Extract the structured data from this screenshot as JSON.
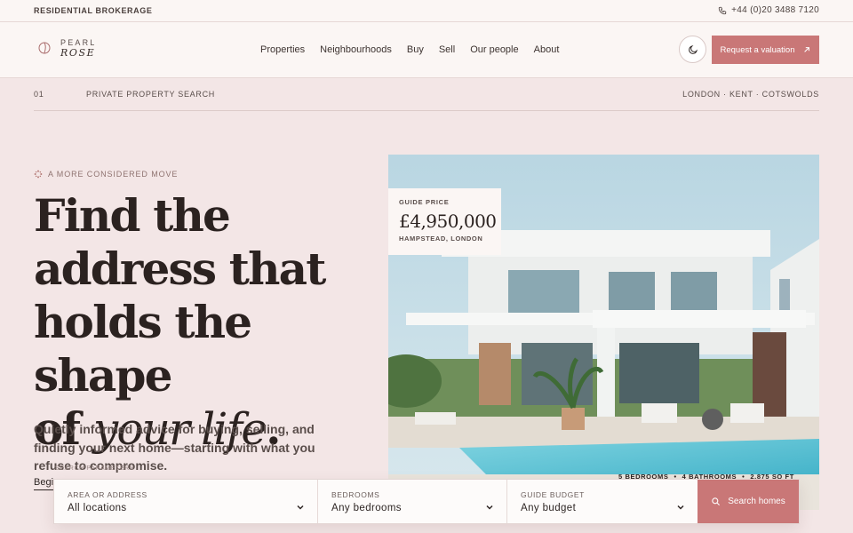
{
  "topbar": {
    "brokerage": "RESIDENTIAL BROKERAGE",
    "phone": "+44 (0)20 3488 7120"
  },
  "brand": {
    "line1": "PEARL",
    "line2": "ROSE"
  },
  "nav": {
    "items": [
      "Properties",
      "Neighbourhoods",
      "Buy",
      "Sell",
      "Our people",
      "About"
    ],
    "cta_label": "Request a valuation"
  },
  "subbar": {
    "number": "01",
    "title": "PRIVATE PROPERTY SEARCH",
    "regions": "LONDON · KENT · COTSWOLDS"
  },
  "hero": {
    "eyebrow": "A MORE CONSIDERED MOVE",
    "headline_line1": "Find the",
    "headline_line2": "address that",
    "headline_line3": "holds the shape",
    "headline_of": "of",
    "headline_italic": "your life",
    "headline_end": ".",
    "lede": "Quietly informed advice for buying, selling, and finding your next home—starting with what you refuse to compromise.",
    "begin_link": "Begin",
    "params_label": "SEARCH PARAMETERS"
  },
  "listing": {
    "price_label": "GUIDE PRICE",
    "price": "£4,950,000",
    "location": "HAMPSTEAD, LONDON",
    "bedrooms": "5 BEDROOMS",
    "bathrooms": "4 BATHROOMS",
    "area": "2,875 SQ FT"
  },
  "search": {
    "area_label": "AREA OR ADDRESS",
    "area_value": "All locations",
    "bedrooms_label": "BEDROOMS",
    "bedrooms_value": "Any bedrooms",
    "budget_label": "GUIDE BUDGET",
    "budget_value": "Any budget",
    "submit_label": "Search homes"
  },
  "colors": {
    "accent": "#c97777",
    "background": "#f3e6e6",
    "text": "#2e2624"
  },
  "icons": [
    "phone-icon",
    "logo-mark-icon",
    "moon-icon",
    "arrow-up-right-icon",
    "sparkle-icon",
    "chevron-down-icon",
    "search-icon"
  ]
}
